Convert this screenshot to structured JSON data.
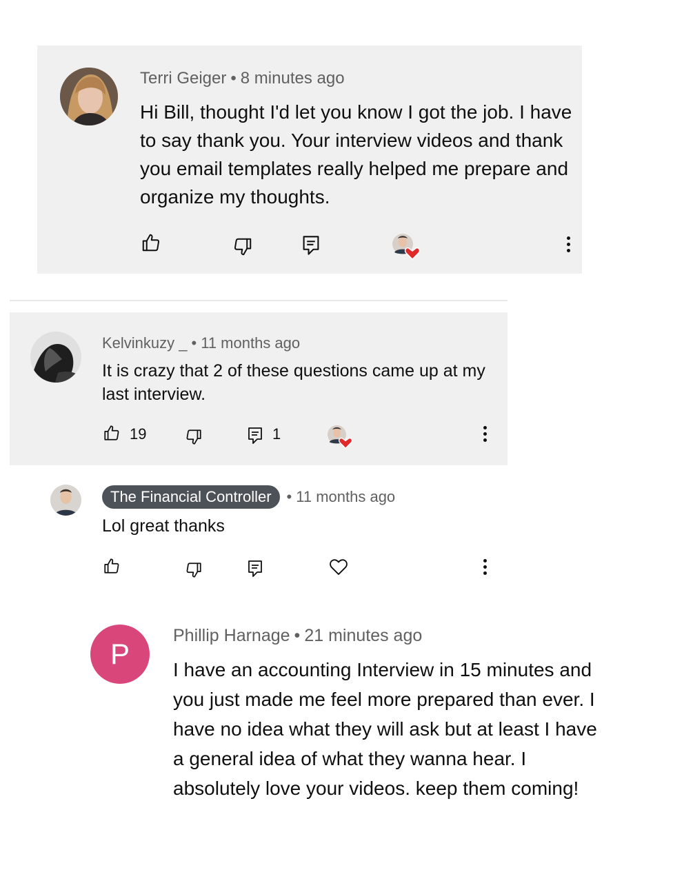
{
  "comments": [
    {
      "author": "Terri Geiger",
      "time": "8 minutes ago",
      "text": "Hi Bill, thought I'd let you know I got the job. I have to say thank you. Your interview videos and thank you email templates really helped me prepare and organize my thoughts.",
      "icons": {
        "like": "thumbs-up-icon",
        "dislike": "thumbs-down-icon",
        "reply": "reply-icon",
        "hearted": "creator-heart-icon",
        "more": "more-vert-icon"
      }
    },
    {
      "author": "Kelvinkuzy _",
      "time": "11 months ago",
      "text": "It is crazy that 2 of these questions came up at my last interview.",
      "likes": "19",
      "replies": "1"
    },
    {
      "author": "The Financial Controller",
      "time": "11 months ago",
      "text": "Lol great thanks",
      "creator_badge_color": "#4d5259"
    },
    {
      "author": "Phillip Harnage",
      "time": "21 minutes ago",
      "text": "I have an accounting Interview in 15 minutes and you just made me feel more prepared than ever. I have no idea what they will ask but at least I have a general idea of what they wanna hear. I absolutely love your videos. keep them coming!",
      "avatar_letter": "P",
      "avatar_color": "#d9477a"
    }
  ],
  "colors": {
    "card_bg": "#f0f0f0",
    "meta_text": "#606060",
    "heart": "#e02a2a"
  }
}
